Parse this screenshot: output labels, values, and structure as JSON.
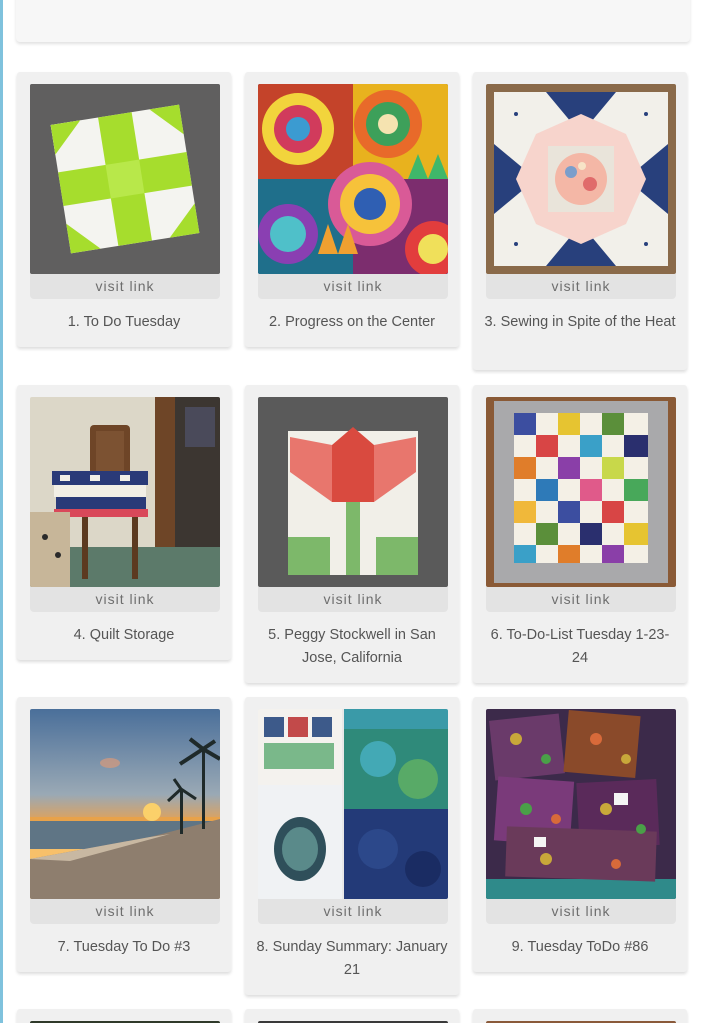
{
  "gallery": {
    "link_label": "visit link",
    "items": [
      {
        "number": "1.",
        "title": "To Do Tuesday",
        "image": "white-and-lime-green-cross-quilt-block-on-gray-felt"
      },
      {
        "number": "2.",
        "title": "Progress on the Center",
        "image": "colorful-new-york-beauty-quilt-with-spiky-circles"
      },
      {
        "number": "3.",
        "title": "Sewing in Spite of the Heat",
        "image": "navy-and-white-sawtooth-star-quilt-block"
      },
      {
        "number": "4.",
        "title": "Quilt Storage",
        "image": "folded-quilts-stacked-on-wooden-chair"
      },
      {
        "number": "5.",
        "title": "Peggy Stockwell in San Jose, California",
        "image": "coral-tulip-quilt-block-on-gray-felt"
      },
      {
        "number": "6.",
        "title": "To-Do-List Tuesday 1-23-24",
        "image": "scrappy-colorful-squares-quilt-with-gray-border"
      },
      {
        "number": "7.",
        "title": "Tuesday To Do #3",
        "image": "sunset-over-beach-with-palm-trees"
      },
      {
        "number": "8.",
        "title": "Sunday Summary: January 21",
        "image": "quilt-patterns-and-blue-batik-fabrics"
      },
      {
        "number": "9.",
        "title": "Tuesday ToDo #86",
        "image": "purple-floral-fabric-pieces-on-teal-table"
      }
    ]
  },
  "colors": {
    "page_background": "#ffffff",
    "card_background": "#f0f0f0",
    "link_bar": "#e3e3e3",
    "caption_text": "#555555",
    "left_accent": "#7fc2dd"
  }
}
